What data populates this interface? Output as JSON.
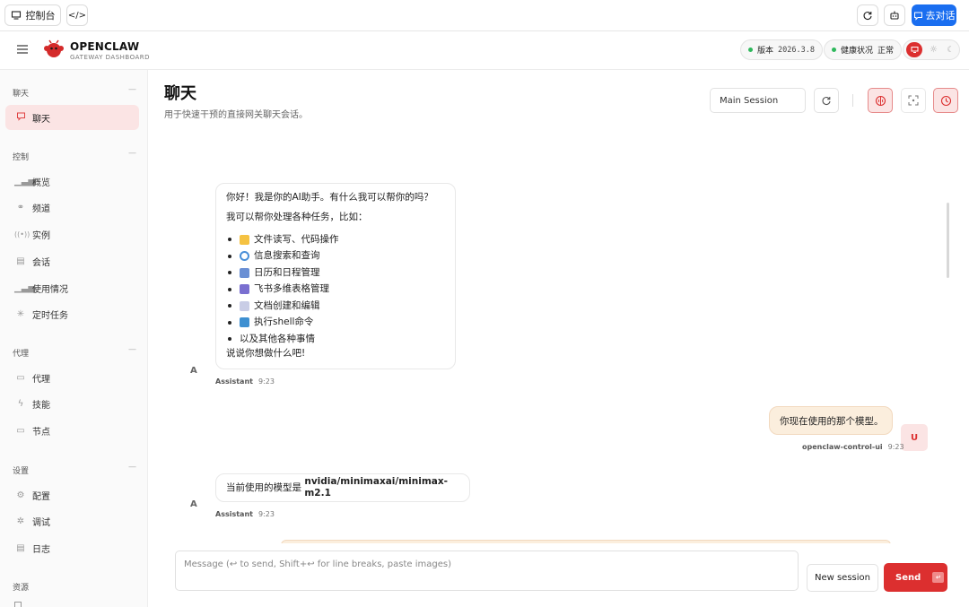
{
  "topbar": {
    "console_label": "控制台",
    "new_chat_label": "去对话"
  },
  "header": {
    "brand_title": "OPENCLAW",
    "brand_subtitle": "GATEWAY DASHBOARD",
    "version_label": "版本",
    "version_value": "2026.3.8",
    "health_label": "健康状况",
    "health_value": "正常"
  },
  "sidebar": {
    "sections": [
      {
        "title": "聊天",
        "items": [
          {
            "label": "聊天",
            "icon": "chat-icon",
            "active": true
          }
        ]
      },
      {
        "title": "控制",
        "items": [
          {
            "label": "概览",
            "icon": "bar-chart-icon"
          },
          {
            "label": "频道",
            "icon": "link-icon"
          },
          {
            "label": "实例",
            "icon": "broadcast-icon"
          },
          {
            "label": "会话",
            "icon": "document-icon"
          },
          {
            "label": "使用情况",
            "icon": "bar-chart-icon"
          },
          {
            "label": "定时任务",
            "icon": "loader-icon"
          }
        ]
      },
      {
        "title": "代理",
        "items": [
          {
            "label": "代理",
            "icon": "folder-icon"
          },
          {
            "label": "技能",
            "icon": "lightning-icon"
          },
          {
            "label": "节点",
            "icon": "monitor-icon"
          }
        ]
      },
      {
        "title": "设置",
        "items": [
          {
            "label": "配置",
            "icon": "gear-icon"
          },
          {
            "label": "调试",
            "icon": "bug-icon"
          },
          {
            "label": "日志",
            "icon": "scroll-icon"
          }
        ]
      },
      {
        "title": "资源",
        "items": []
      }
    ]
  },
  "page": {
    "title": "聊天",
    "subtitle": "用于快速干预的直接网关聊天会话。",
    "session_select": "Main Session"
  },
  "messages": [
    {
      "role": "assistant",
      "avatar": "A",
      "intro": "你好！我是你的AI助手。有什么我可以帮你的吗？",
      "lead": "我可以帮你处理各种任务，比如：",
      "items": [
        {
          "text": "文件读写、代码操作",
          "icon": "folder-icon",
          "color": "#f5c242"
        },
        {
          "text": "信息搜索和查询",
          "icon": "magnifier-icon",
          "color": "#4a8fd8"
        },
        {
          "text": "日历和日程管理",
          "icon": "calendar-icon",
          "color": "#6a8fd4"
        },
        {
          "text": "飞书多维表格管理",
          "icon": "bar-chart-icon",
          "color": "#7a6fd0"
        },
        {
          "text": "文档创建和编辑",
          "icon": "document-icon",
          "color": "#c9cde6"
        },
        {
          "text": "执行shell命令",
          "icon": "terminal-icon",
          "color": "#3d8fd1"
        },
        {
          "text": "以及其他各种事情",
          "icon": "",
          "color": ""
        }
      ],
      "outro": "说说你想做什么吧!",
      "sender": "Assistant",
      "time": "9:23"
    },
    {
      "role": "user",
      "avatar": "U",
      "text": "你现在使用的那个模型。",
      "sender": "openclaw-control-ui",
      "time": "9:23"
    },
    {
      "role": "assistant",
      "avatar": "A",
      "prefix": "当前使用的模型是 ",
      "model": "nvidia/minimaxai/minimax-m2.1",
      "sender": "Assistant",
      "time": "9:23"
    }
  ],
  "composer": {
    "placeholder": "Message (↩ to send, Shift+↩ for line breaks, paste images)",
    "new_session_label": "New session",
    "send_label": "Send"
  },
  "colors": {
    "accent_red": "#dc2f2f",
    "primary_blue": "#1a6ef0",
    "user_bubble": "#fbeedd",
    "active_nav": "#fbe4e4",
    "status_green": "#2eb85c"
  }
}
